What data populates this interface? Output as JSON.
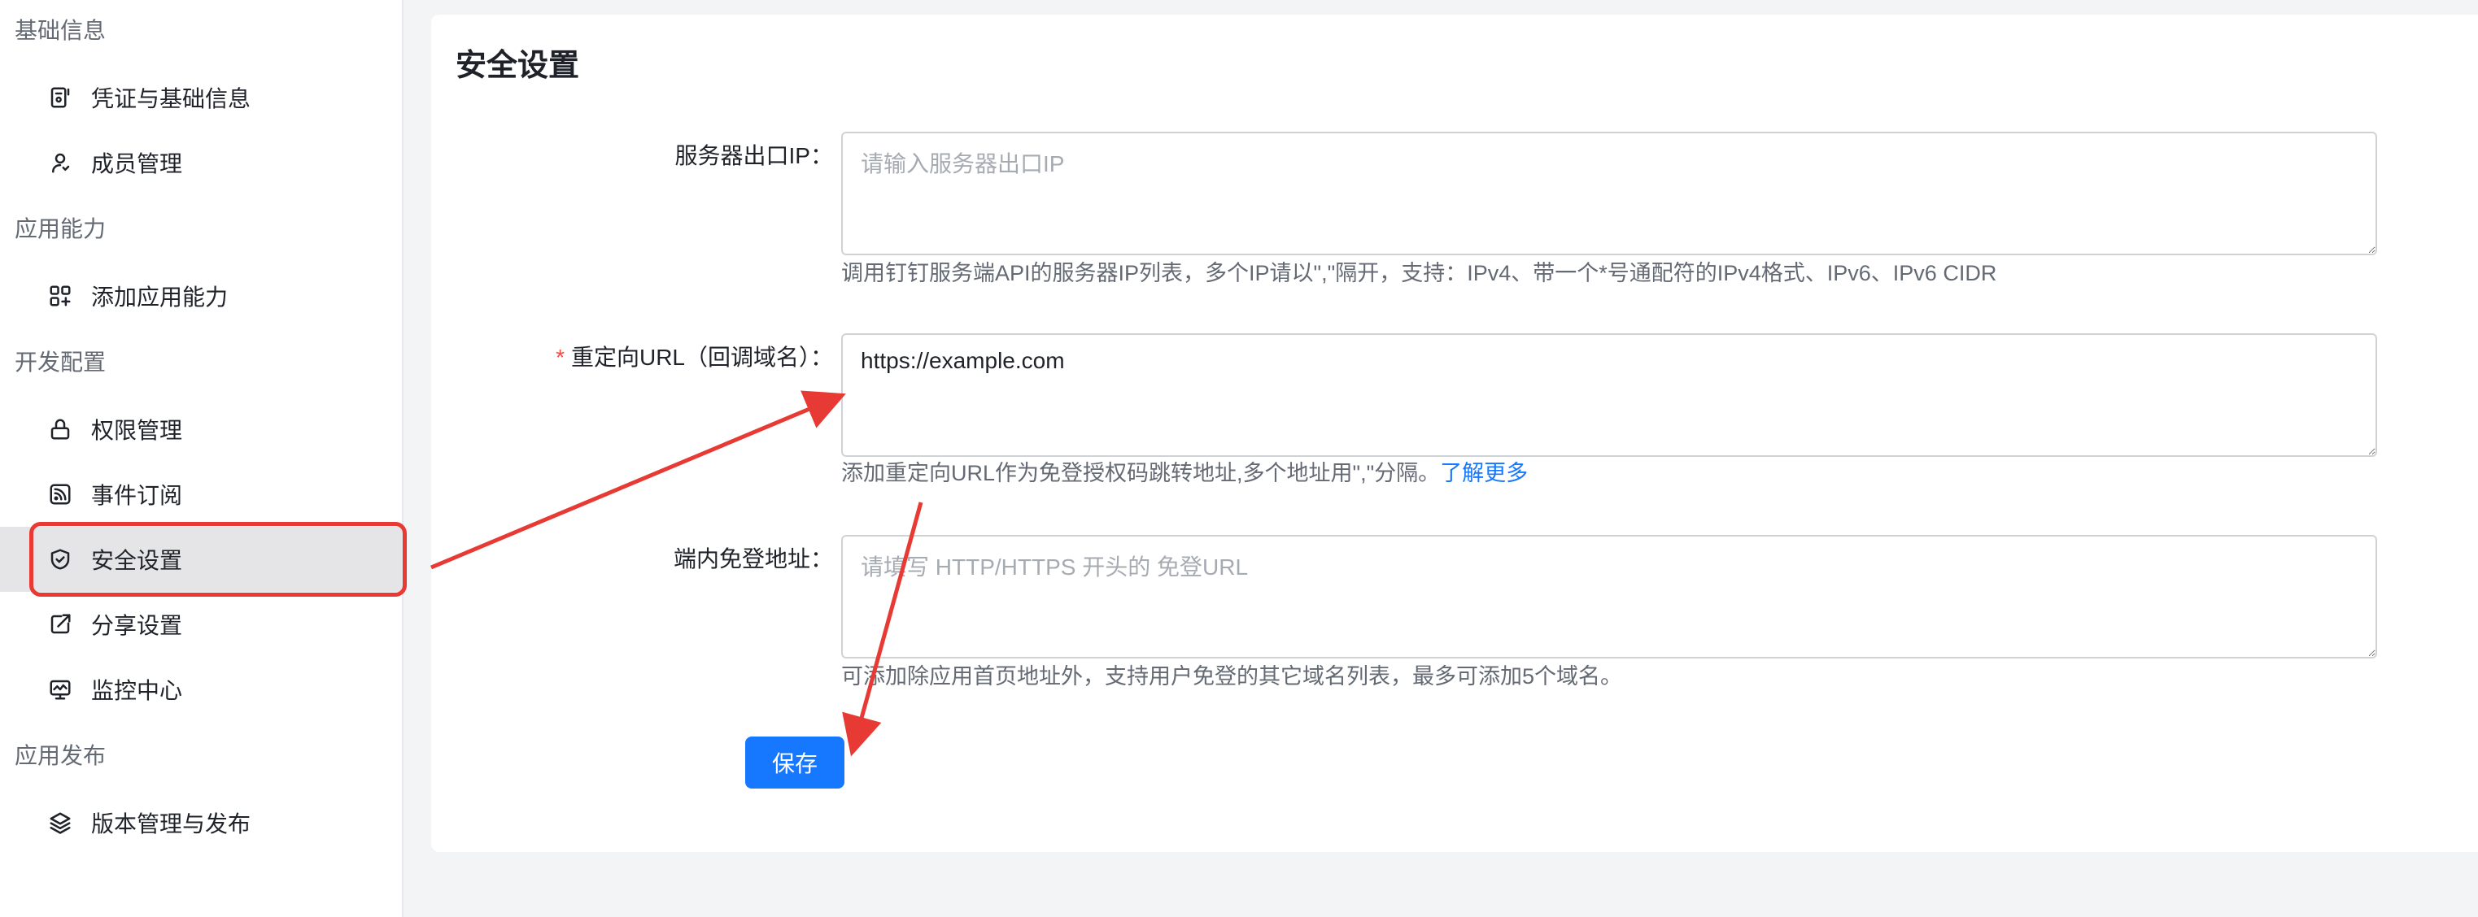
{
  "sidebar": {
    "groups": [
      {
        "title": "基础信息"
      },
      {
        "title": "应用能力"
      },
      {
        "title": "开发配置"
      },
      {
        "title": "应用发布"
      }
    ],
    "items": [
      {
        "label": "凭证与基础信息",
        "icon": "credential-icon"
      },
      {
        "label": "成员管理",
        "icon": "user-icon"
      },
      {
        "label": "添加应用能力",
        "icon": "apps-add-icon"
      },
      {
        "label": "权限管理",
        "icon": "lock-icon"
      },
      {
        "label": "事件订阅",
        "icon": "rss-icon"
      },
      {
        "label": "安全设置",
        "icon": "shield-check-icon",
        "active": true
      },
      {
        "label": "分享设置",
        "icon": "external-link-icon"
      },
      {
        "label": "监控中心",
        "icon": "monitor-icon"
      },
      {
        "label": "版本管理与发布",
        "icon": "layers-icon"
      }
    ]
  },
  "page": {
    "title": "安全设置"
  },
  "form": {
    "server_ip": {
      "label": "服务器出口IP：",
      "placeholder": "请输入服务器出口IP",
      "value": "",
      "help": "调用钉钉服务端API的服务器IP列表，多个IP请以\",\"隔开，支持：IPv4、带一个*号通配符的IPv4格式、IPv6、IPv6 CIDR"
    },
    "redirect_url": {
      "required_mark": "*",
      "label": "重定向URL（回调域名）：",
      "placeholder": "",
      "value": "https://example.com",
      "help": "添加重定向URL作为免登授权码跳转地址,多个地址用\",\"分隔。",
      "help_link": "了解更多"
    },
    "inner_login": {
      "label": "端内免登地址：",
      "placeholder": "请填写 HTTP/HTTPS 开头的 免登URL",
      "value": "",
      "help": "可添加除应用首页地址外，支持用户免登的其它域名列表，最多可添加5个域名。"
    },
    "save_label": "保存"
  },
  "colors": {
    "primary": "#1677ff",
    "annotation_red": "#e83a34",
    "required": "#f54a45"
  }
}
